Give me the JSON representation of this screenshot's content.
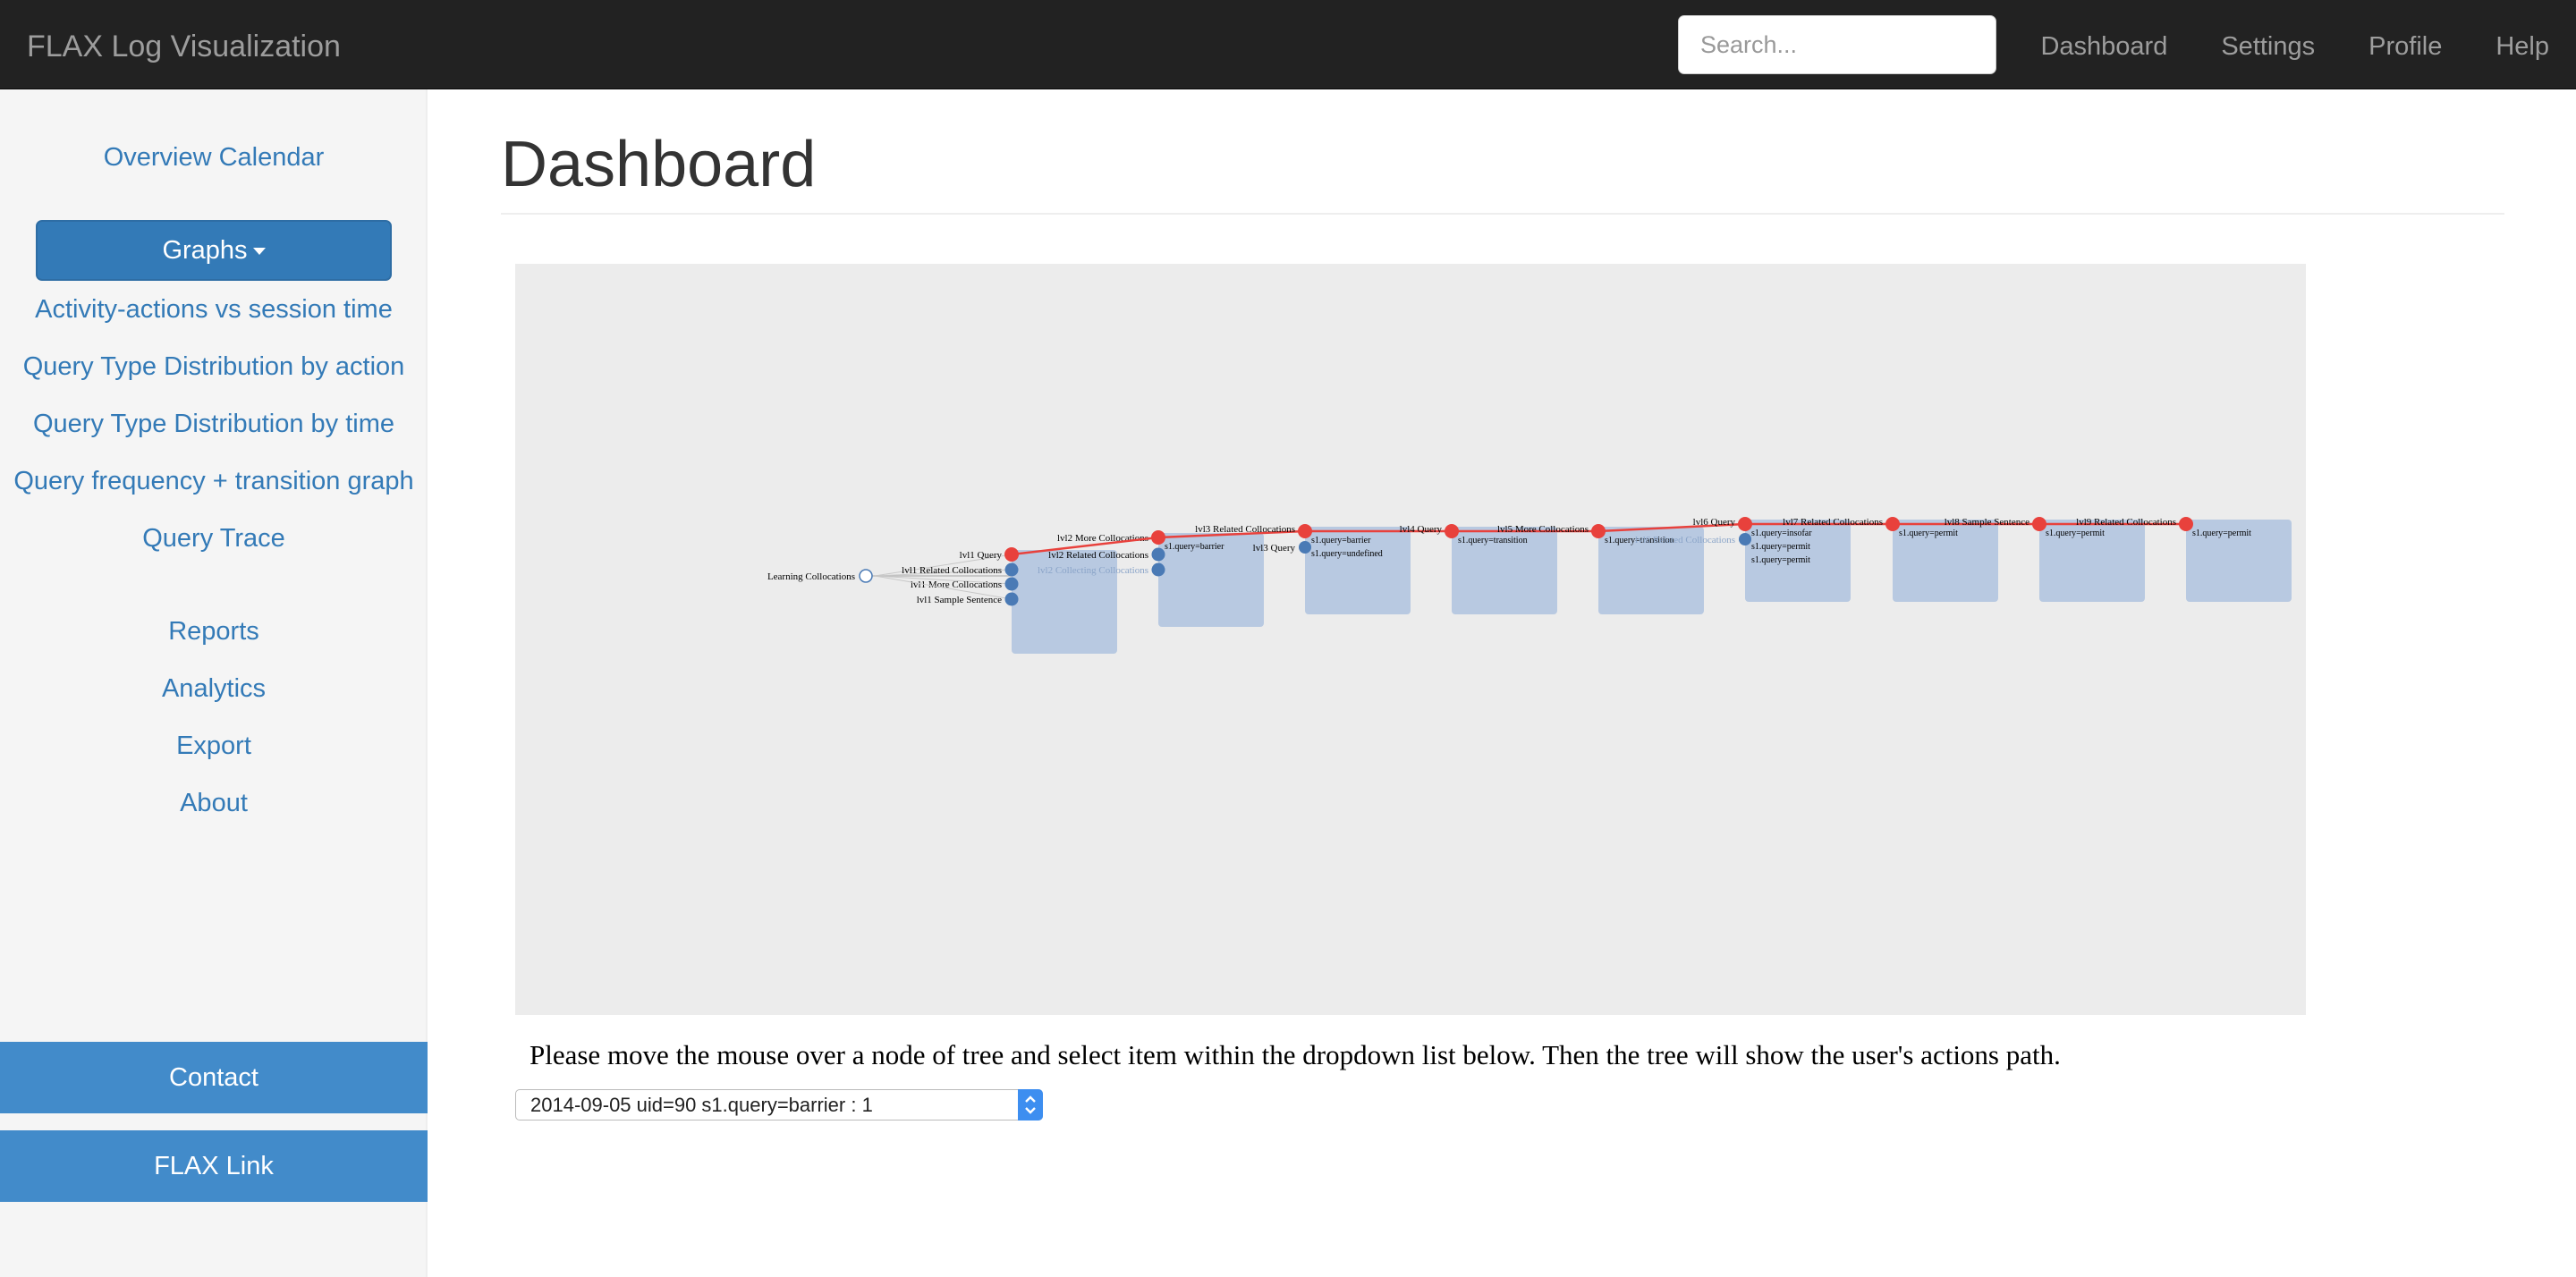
{
  "navbar": {
    "brand": "FLAX Log Visualization",
    "search_placeholder": "Search...",
    "links": [
      "Dashboard",
      "Settings",
      "Profile",
      "Help"
    ]
  },
  "sidebar": {
    "overview": "Overview Calendar",
    "graphs_button": "Graphs",
    "graph_items": [
      "Activity-actions vs session time",
      "Query Type Distribution by action",
      "Query Type Distribution by time",
      "Query frequency + transition graph",
      "Query Trace"
    ],
    "other_items": [
      "Reports",
      "Analytics",
      "Export",
      "About"
    ],
    "contact": "Contact",
    "flax_link": "FLAX Link"
  },
  "main": {
    "title": "Dashboard",
    "instruction": "Please move the mouse over a node of tree and select item within the dropdown list below. Then the tree will show the user's actions path.",
    "selected_option": "2014-09-05 uid=90 s1.query=barrier : 1"
  },
  "tree": {
    "root": "Learning Collocations",
    "lvl1": [
      "lvl1 Query",
      "lvl1 Related Collocations",
      "lvl1 More Collocations",
      "lvl1 Sample Sentence"
    ],
    "lvl2": [
      "lvl2 More Collocations",
      "lvl2 Related Collocations",
      "lvl2 Collecting Collocations"
    ],
    "path_labels": [
      "lvl3 Related Collocations",
      "lvl4 Query",
      "lvl5 More Collocations",
      "lvl6 Query",
      "lvl7 Related Collocations",
      "lvl8 Sample Sentence",
      "lvl9 Related Collocations"
    ],
    "side_labels": [
      "lvl3 Query",
      "lvl6 Related Collocations"
    ],
    "boxes": [
      [],
      [
        "s1.query=barrier"
      ],
      [
        "s1.query=barrier",
        "s1.query=undefined"
      ],
      [
        "s1.query=transition"
      ],
      [
        "s1.query=transition"
      ],
      [
        "s1.query=insofar",
        "s1.query=permit",
        "s1.query=permit"
      ],
      [
        "s1.query=permit"
      ],
      [
        "s1.query=permit"
      ],
      [
        "s1.query=permit"
      ]
    ],
    "colors": {
      "path": "#e8413c",
      "node": "#4a7ab5",
      "box": "#b8c9e1"
    }
  }
}
